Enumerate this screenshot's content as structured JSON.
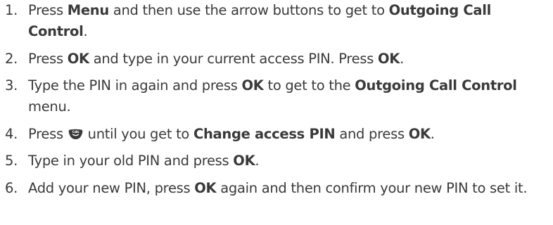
{
  "steps": [
    {
      "num": "1.",
      "t1": "Press ",
      "b1": "Menu",
      "t2": " and then use the arrow buttons to get to ",
      "b2": "Outgoing Call Control",
      "t3": "."
    },
    {
      "num": "2.",
      "t1": "Press ",
      "b1": "OK",
      "t2": " and type in your current access PIN. Press ",
      "b2": "OK",
      "t3": "."
    },
    {
      "num": "3.",
      "t1": "Type the PIN in again and press ",
      "b1": "OK",
      "t2": " to get to the ",
      "b2": "Outgoing Call Control",
      "t3": " menu."
    },
    {
      "num": "4.",
      "t1": "Press ",
      "icon": "calls-button-icon",
      "icon_text": "Calls",
      "t2": " until you get to ",
      "b1": "Change access PIN",
      "t3": " and press ",
      "b2": "OK",
      "t4": "."
    },
    {
      "num": "5.",
      "t1": "Type in your old PIN and press ",
      "b1": "OK",
      "t2": "."
    },
    {
      "num": "6.",
      "t1": "Add your new PIN, press ",
      "b1": "OK",
      "t2": " again and then confirm your new PIN to set it."
    }
  ],
  "colors": {
    "text": "#3a3a3a",
    "icon_fill": "#3a3a3a",
    "icon_text": "#ffffff"
  }
}
